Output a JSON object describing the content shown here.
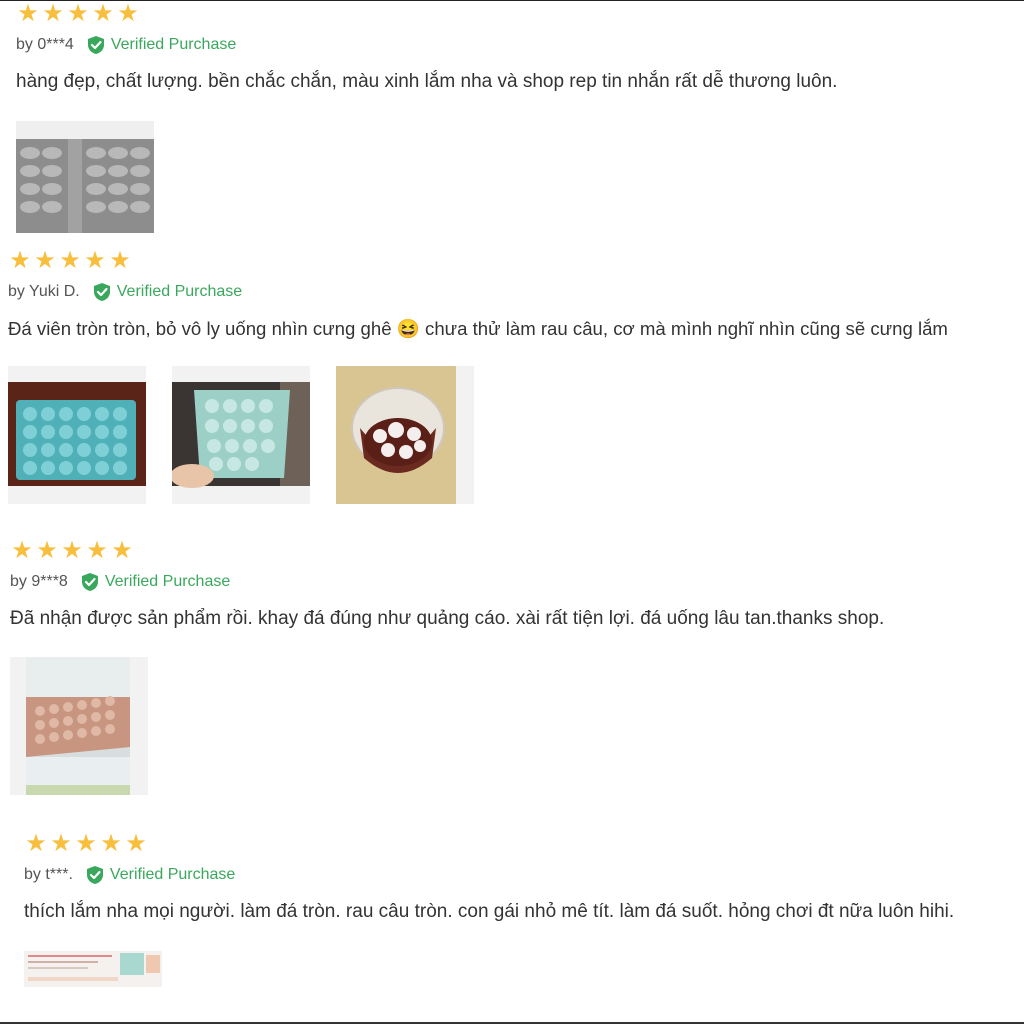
{
  "reviews": [
    {
      "rating": 5,
      "author": "by 0***4",
      "verified_label": "Verified Purchase",
      "text": "hàng đẹp, chất lượng. bền chắc chắn, màu xinh lắm nha và shop rep tin nhắn rất dễ thương luôn.",
      "images": [
        "gray ice tray"
      ]
    },
    {
      "rating": 5,
      "author": "by Yuki D.",
      "verified_label": "Verified Purchase",
      "text": "Đá viên tròn tròn, bỏ vô ly uống nhìn cưng ghê 😆 chưa thử làm rau câu, cơ mà mình nghĩ nhìn cũng sẽ cưng lắm",
      "images": [
        "blue ice tray",
        "ice tray in hand",
        "glass with round ice"
      ]
    },
    {
      "rating": 5,
      "author": "by 9***8",
      "verified_label": "Verified Purchase",
      "text": "Đã nhận được sản phẩm rồi. khay đá đúng như quảng cáo. xài rất tiện lợi. đá uống lâu tan.thanks shop.",
      "images": [
        "trays in freezer"
      ]
    },
    {
      "rating": 5,
      "author": "by t***.",
      "verified_label": "Verified Purchase",
      "text": "thích lắm nha mọi người. làm đá tròn. rau câu tròn. con gái nhỏ mê tít. làm đá suốt. hỏng chơi đt nữa luôn hihi.",
      "images": [
        "chat screenshot"
      ]
    }
  ],
  "colors": {
    "star": "#f7bf3d",
    "verified": "#3aa85c",
    "text": "#333333"
  },
  "icons": {
    "star": "star-icon",
    "verified": "shield-check-icon"
  }
}
